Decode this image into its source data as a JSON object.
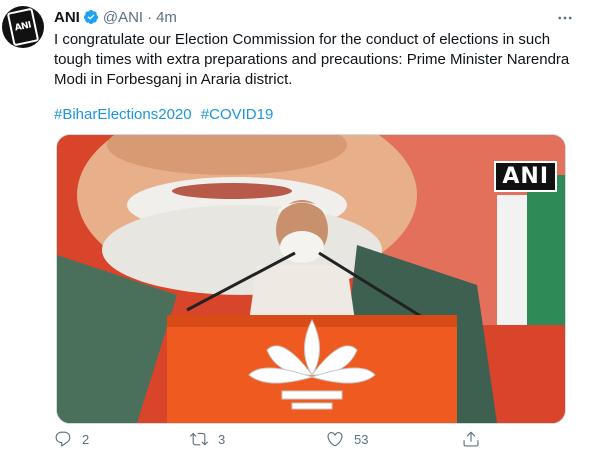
{
  "tweet": {
    "author_name": "ANI",
    "handle": "@ANI",
    "separator": "·",
    "time": "4m",
    "text": "I congratulate our Election Commission for the conduct of elections in such tough times with extra preparations and precautions: Prime Minister Narendra Modi in Forbesganj in Araria district.",
    "hashtags": [
      "#BiharElections2020",
      "#COVID19"
    ],
    "media_watermark": "ANI",
    "avatar_logo": "ANI",
    "counts": {
      "replies": "2",
      "retweets": "3",
      "likes": "53"
    }
  },
  "colors": {
    "link": "#1b95e0",
    "secondary": "#5b7083",
    "verified": "#1da1f2",
    "stage_orange": "#e8561f"
  },
  "icons": [
    "verified-badge-icon",
    "more-icon",
    "reply-icon",
    "retweet-icon",
    "like-icon",
    "share-icon"
  ]
}
